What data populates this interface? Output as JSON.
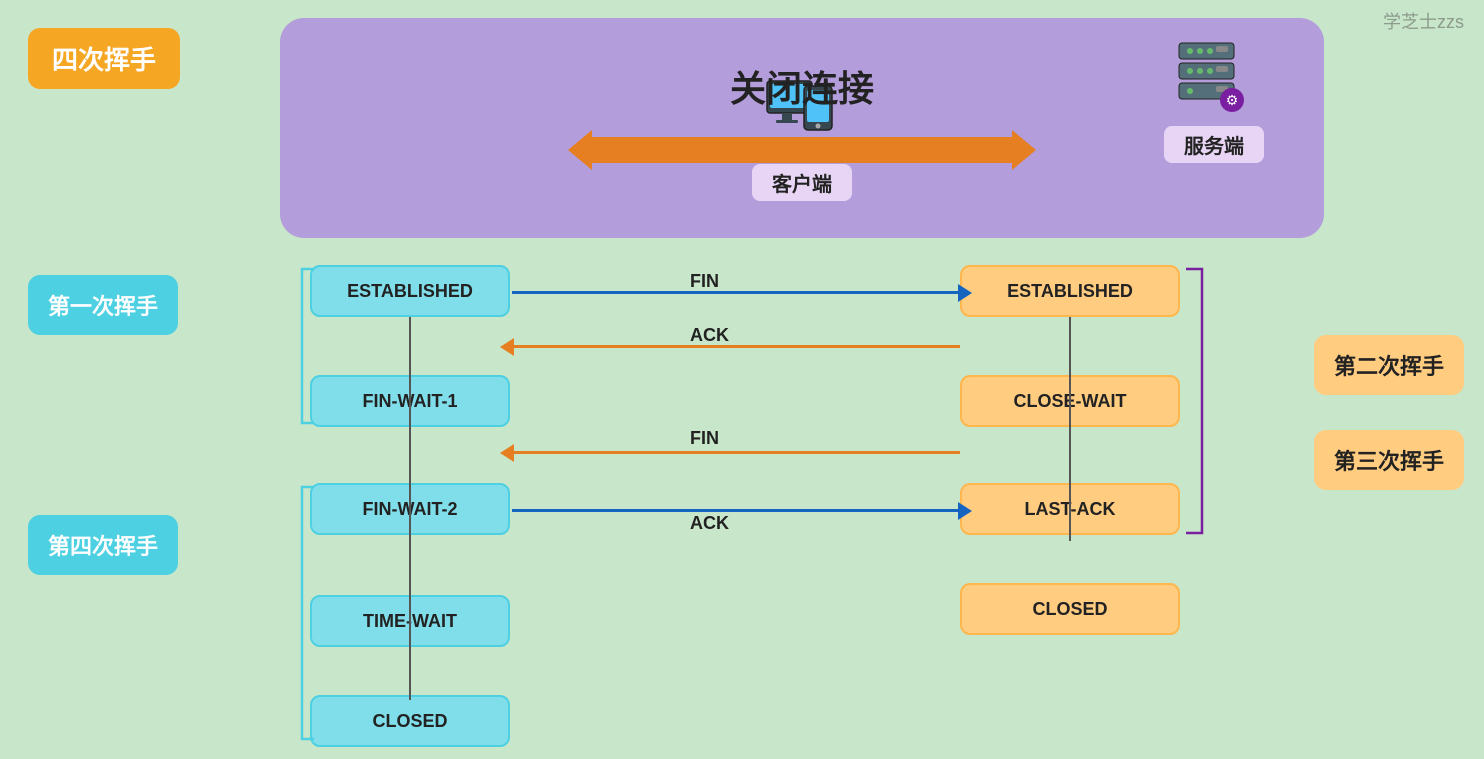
{
  "watermark": "学芝士zzs",
  "top": {
    "badge": "四次挥手",
    "connection_label": "关闭连接",
    "client_label": "客户端",
    "server_label": "服务端"
  },
  "left_labels": {
    "handshake1": "第一次挥手",
    "handshake4": "第四次挥手"
  },
  "right_labels": {
    "handshake2": "第二次挥手",
    "handshake3": "第三次挥手"
  },
  "client_states": [
    "ESTABLISHED",
    "FIN-WAIT-1",
    "FIN-WAIT-2",
    "TIME-WAIT",
    "CLOSED"
  ],
  "server_states": [
    "ESTABLISHED",
    "CLOSE-WAIT",
    "LAST-ACK",
    "CLOSED"
  ],
  "arrows": [
    {
      "label": "FIN",
      "direction": "right"
    },
    {
      "label": "ACK",
      "direction": "left"
    },
    {
      "label": "FIN",
      "direction": "left"
    },
    {
      "label": "ACK",
      "direction": "right"
    }
  ]
}
